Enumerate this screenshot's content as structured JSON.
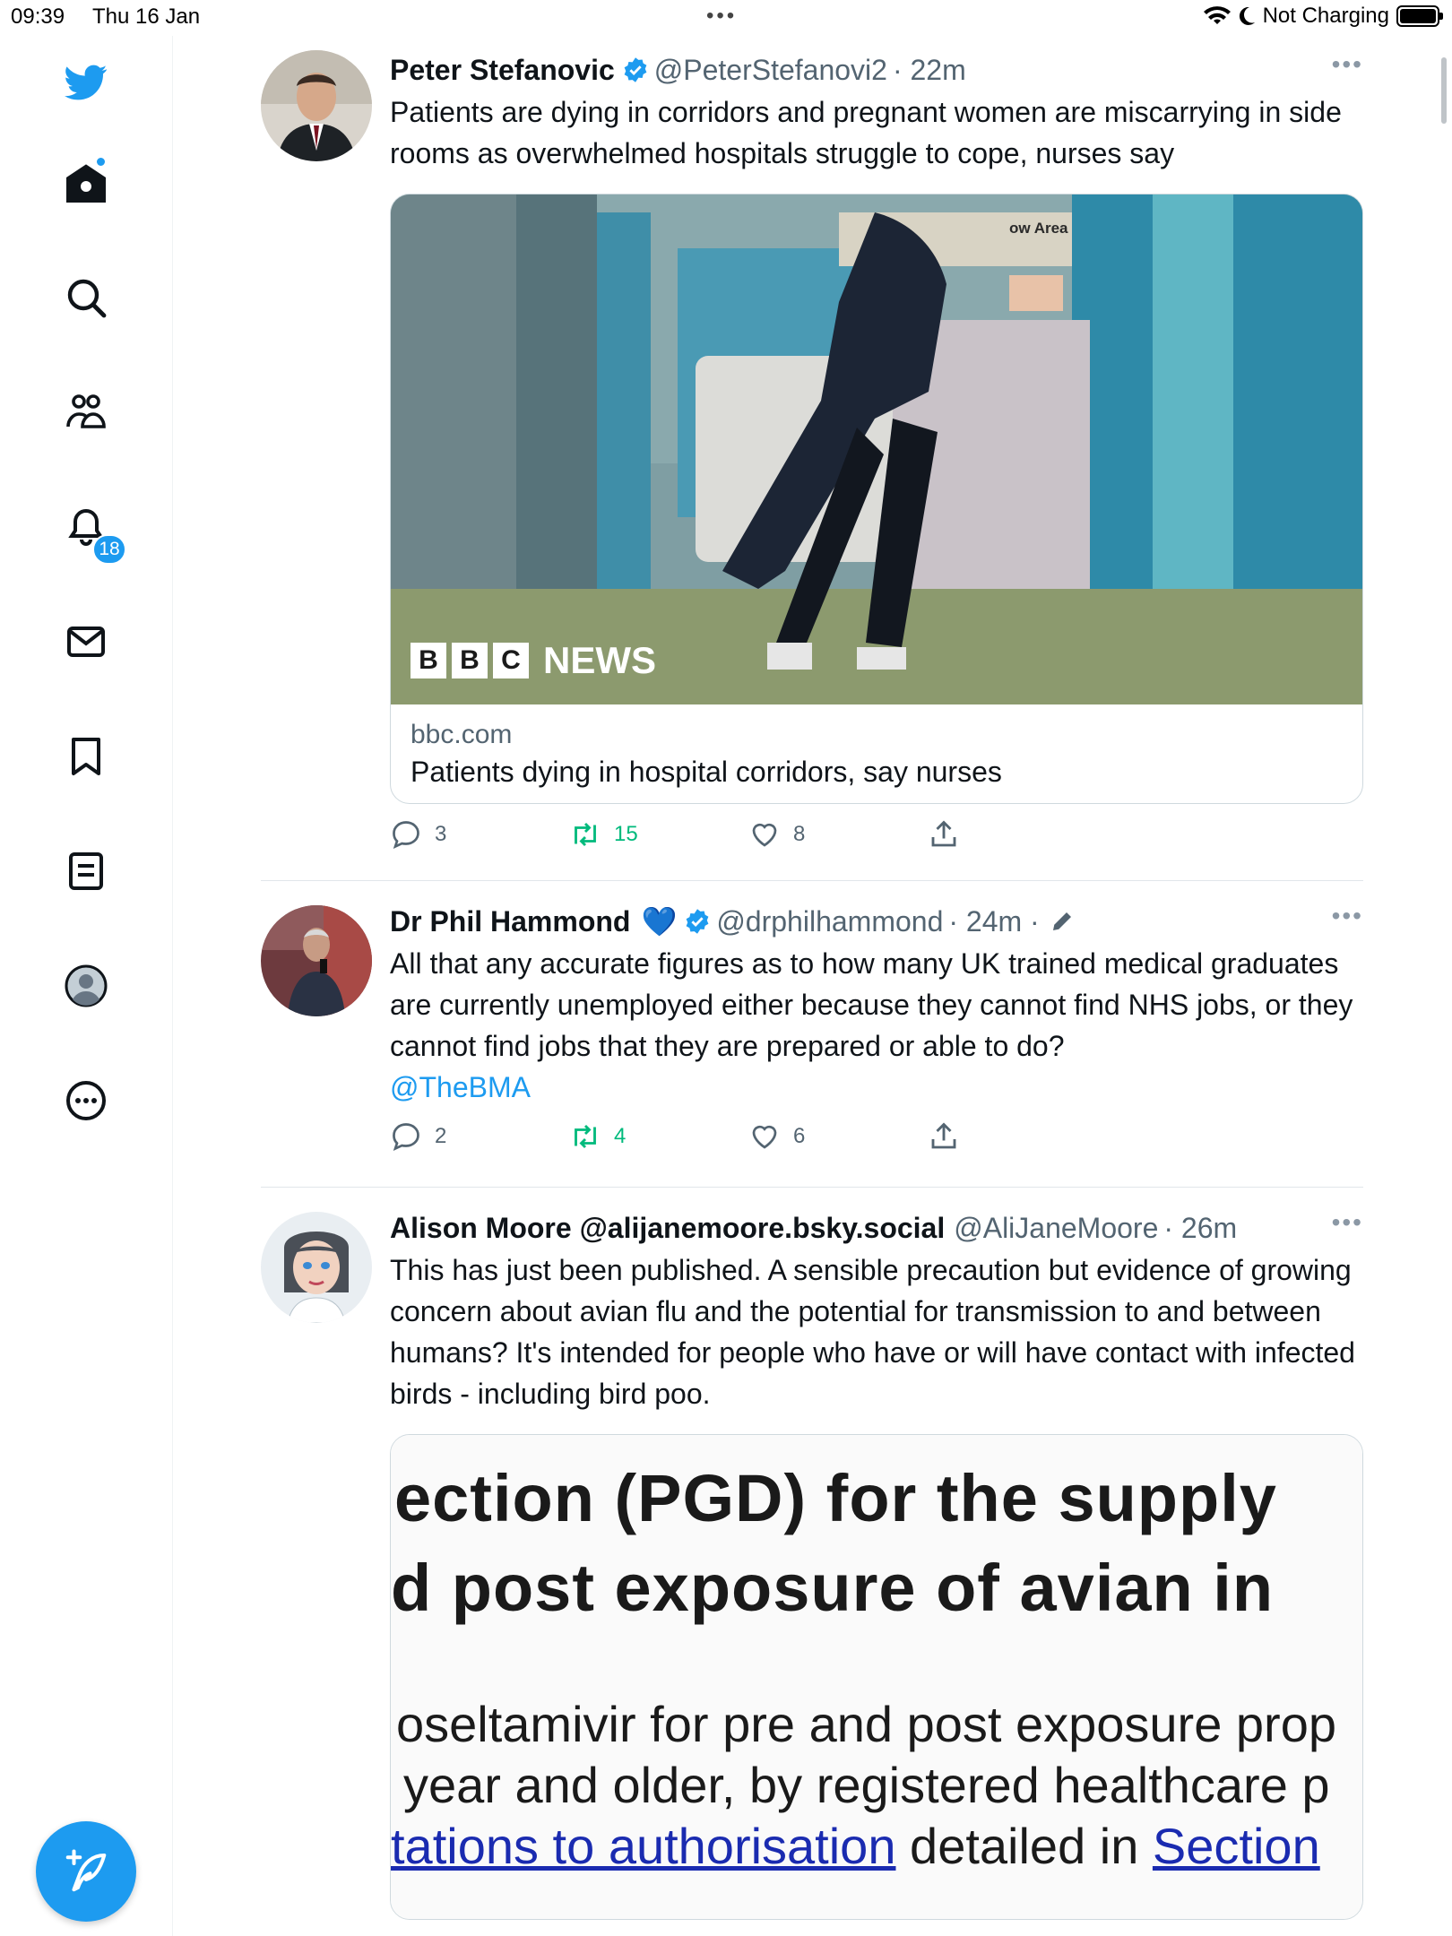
{
  "status_bar": {
    "time": "09:39",
    "date": "Thu 16 Jan",
    "charging": "Not Charging"
  },
  "sidebar": {
    "items": [
      {
        "icon": "twitter-logo-icon"
      },
      {
        "icon": "home-icon"
      },
      {
        "icon": "search-icon"
      },
      {
        "icon": "communities-icon"
      },
      {
        "icon": "notifications-icon",
        "badge": "18"
      },
      {
        "icon": "messages-icon"
      },
      {
        "icon": "bookmarks-icon"
      },
      {
        "icon": "lists-icon"
      },
      {
        "icon": "profile-icon"
      },
      {
        "icon": "more-icon"
      }
    ],
    "notification_badge": "18",
    "accent_color": "#1d9bf0"
  },
  "tweets": [
    {
      "name": "Peter Stefanovic",
      "handle": "@PeterStefanovi2",
      "time": "· 22m",
      "text": "Patients are dying in corridors and pregnant women are miscarrying in side rooms as overwhelmed hospitals struggle to cope, nurses say",
      "card": {
        "domain": "bbc.com",
        "title": "Patients dying in hospital corridors, say nurses",
        "image_sign": "ow Area",
        "logo_letters": [
          "B",
          "B",
          "C"
        ],
        "logo_word": "NEWS"
      },
      "replies": "3",
      "retweets": "15",
      "likes": "8"
    },
    {
      "name": "Dr Phil Hammond",
      "name_emoji": "💙",
      "handle": "@drphilhammond",
      "time": "· 24m ·",
      "text": "All that any accurate figures as to how many UK trained medical graduates are currently unemployed either because they cannot find NHS jobs, or they cannot find jobs that they are prepared or able to do?",
      "mention": "@TheBMA",
      "replies": "2",
      "retweets": "4",
      "likes": "6"
    },
    {
      "name": "Alison Moore @alijanemoore.bsky.social",
      "handle": "@AliJaneMoore",
      "time": "· 26m",
      "text": "This has just been published. A sensible precaution but evidence of growing concern about avian flu and the potential for transmission to and between humans? It's intended for people who have or will have contact with infected birds - including bird poo.",
      "doc_lines": {
        "line1": "ection (PGD) for the supply",
        "line2": "d post exposure of avian in",
        "line3": "oseltamivir for pre and post exposure prop",
        "line4": "year and older, by registered healthcare p",
        "line5_link": "tations to authorisation",
        "line5_mid": " detailed in ",
        "line5_link2": "Section"
      }
    }
  ]
}
